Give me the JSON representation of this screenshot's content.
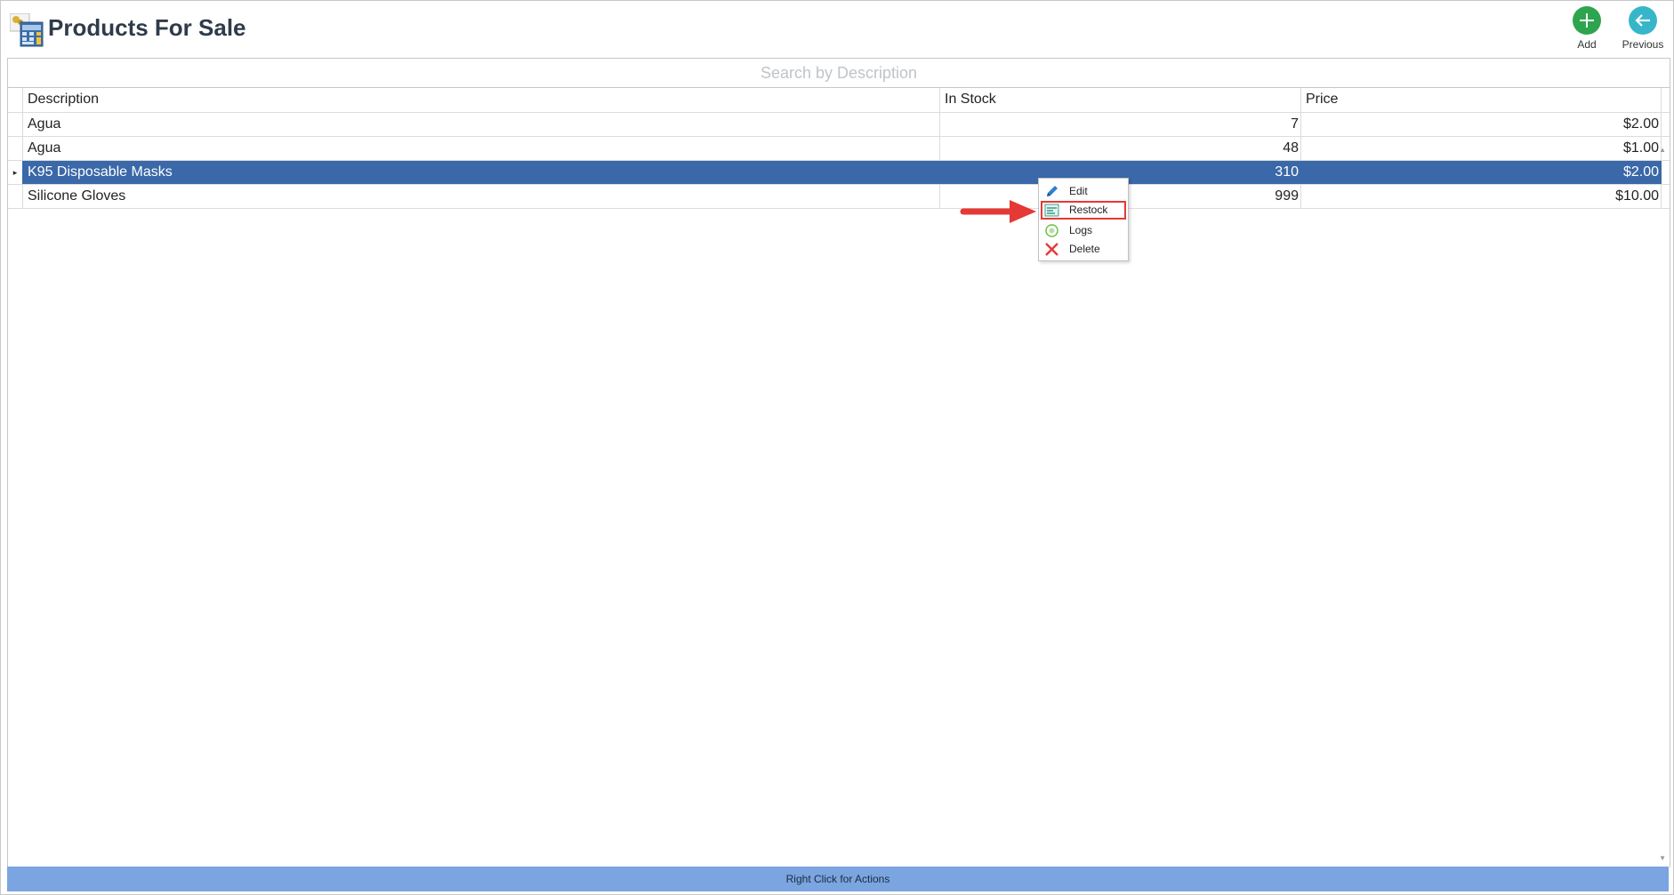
{
  "header": {
    "title": "Products For Sale",
    "add_label": "Add",
    "previous_label": "Previous"
  },
  "search": {
    "placeholder": "Search by Description",
    "value": ""
  },
  "grid": {
    "columns": [
      "Description",
      "In Stock",
      "Price"
    ],
    "rows": [
      {
        "description": "Agua",
        "in_stock": "7",
        "price": "$2.00"
      },
      {
        "description": "Agua",
        "in_stock": "48",
        "price": "$1.00"
      },
      {
        "description": "K95 Disposable Masks",
        "in_stock": "310",
        "price": "$2.00"
      },
      {
        "description": "Silicone Gloves",
        "in_stock": "999",
        "price": "$10.00"
      }
    ],
    "selected_row": 2
  },
  "context_menu": {
    "items": [
      {
        "label": "Edit",
        "icon": "pencil-icon"
      },
      {
        "label": "Restock",
        "icon": "restock-icon"
      },
      {
        "label": "Logs",
        "icon": "logs-icon"
      },
      {
        "label": "Delete",
        "icon": "delete-x-icon"
      }
    ],
    "highlighted": "Restock"
  },
  "status": {
    "text": "Right Click for Actions"
  },
  "colors": {
    "selection": "#3a68a8",
    "status_bar": "#7aa5e0",
    "add_button": "#2ea44f",
    "previous_button": "#37b6c9",
    "highlight_border": "#e53935"
  }
}
